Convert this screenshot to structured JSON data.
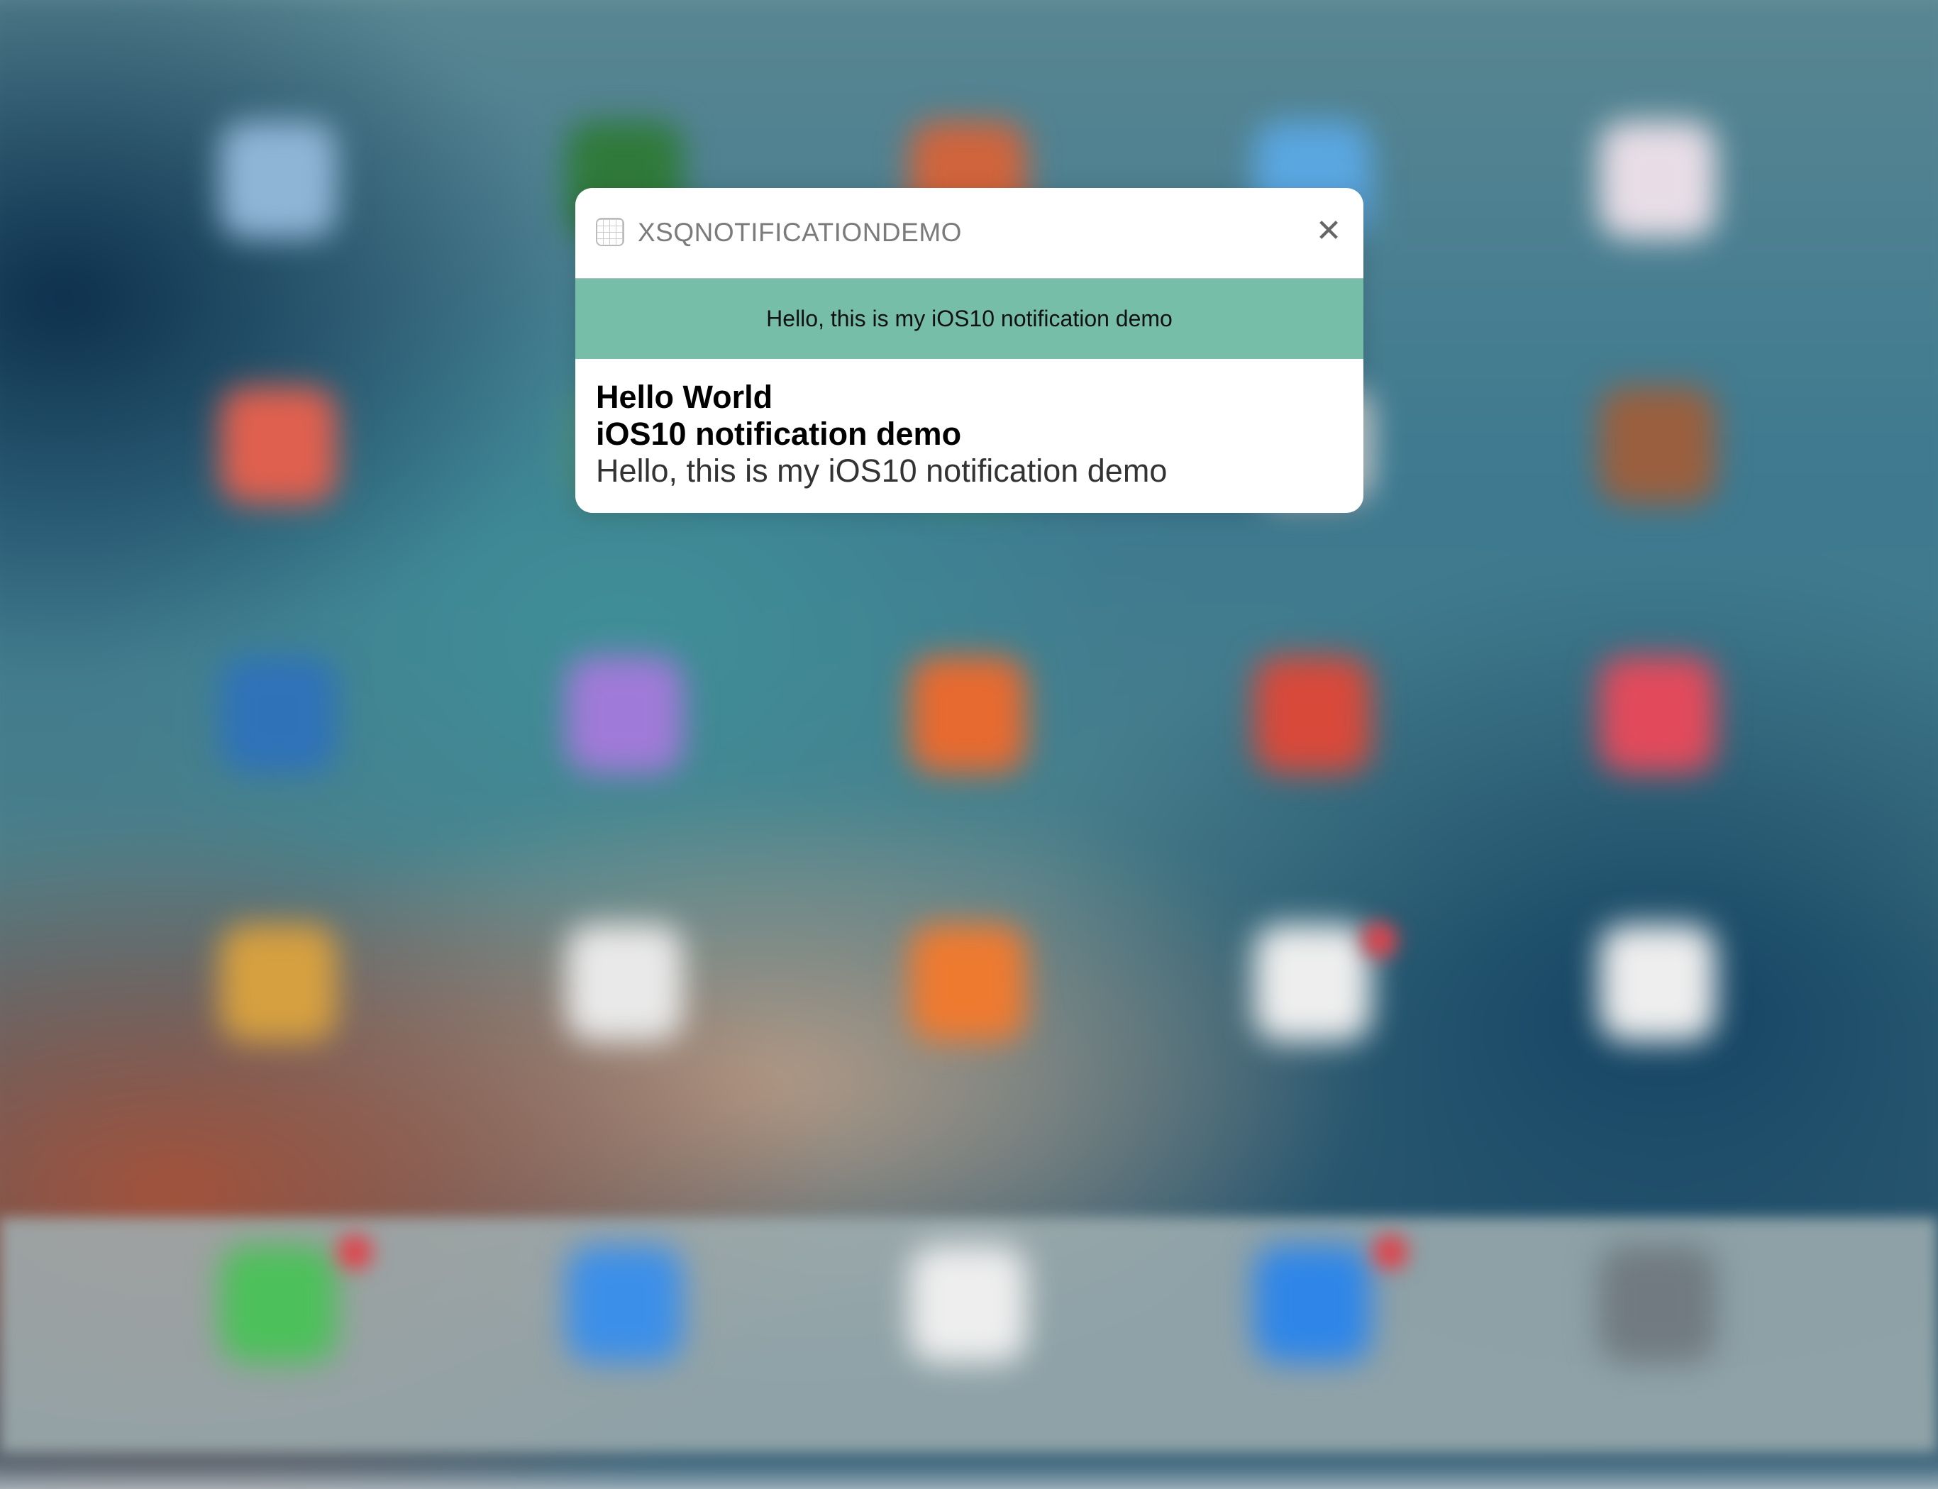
{
  "notification": {
    "app_name": "XSQNOTIFICATIONDEMO",
    "app_icon": "grid-placeholder-icon",
    "close_icon": "close-x-icon",
    "close_label": "✕",
    "banner_text": "Hello, this is my iOS10 notification demo",
    "banner_color": "#76bea8",
    "title": "Hello World",
    "subtitle": "iOS10 notification demo",
    "body": "Hello, this is my iOS10 notification demo"
  },
  "home_screen": {
    "app_icon_colors": [
      [
        "#8fb5d6",
        "#2f7a3a",
        "#d0643c",
        "#5aa6e0",
        "#e8dde6"
      ],
      [
        "#e0604f",
        "#4d8f7e",
        "#3f9a78",
        "#d6d6d6",
        "#9a5f3e"
      ],
      [
        "#2f72b8",
        "#a07ad8",
        "#e76a30",
        "#d8493a",
        "#e24a5c"
      ],
      [
        "#d6a040",
        "#e9e9e9",
        "#ee7a30",
        "#eeeeee",
        "#eeeeee"
      ]
    ],
    "dock_icon_colors": [
      "#4cc05a",
      "#3c8fe8",
      "#eeeeee",
      "#2f86e8",
      "#707a80"
    ]
  }
}
